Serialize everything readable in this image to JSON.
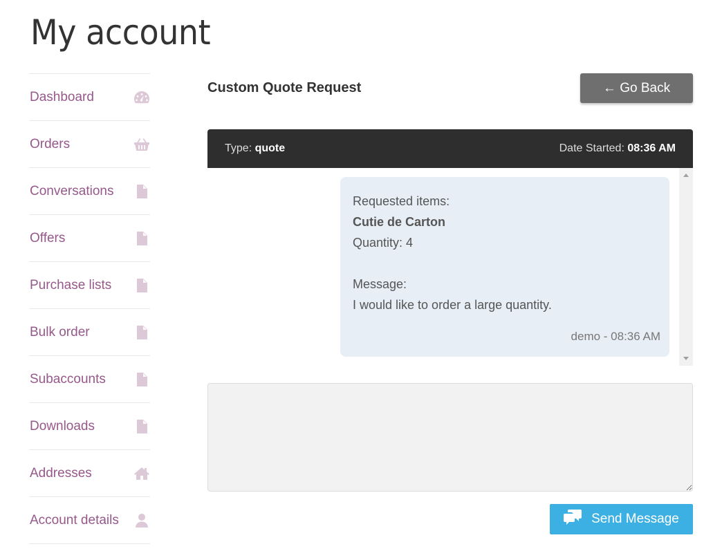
{
  "page": {
    "title": "My account"
  },
  "sidebar": {
    "items": [
      {
        "label": "Dashboard",
        "icon": "dashboard-icon"
      },
      {
        "label": "Orders",
        "icon": "basket-icon"
      },
      {
        "label": "Conversations",
        "icon": "document-icon"
      },
      {
        "label": "Offers",
        "icon": "document-icon"
      },
      {
        "label": "Purchase lists",
        "icon": "document-icon"
      },
      {
        "label": "Bulk order",
        "icon": "document-icon"
      },
      {
        "label": "Subaccounts",
        "icon": "document-icon"
      },
      {
        "label": "Downloads",
        "icon": "file-download-icon"
      },
      {
        "label": "Addresses",
        "icon": "home-icon"
      },
      {
        "label": "Account details",
        "icon": "user-icon"
      }
    ]
  },
  "conversation": {
    "title": "Custom Quote Request",
    "back_label": "← Go Back",
    "type_label": "Type:",
    "type_value": "quote",
    "date_label": "Date Started:",
    "date_value": "08:36 AM",
    "message": {
      "line1": "Requested items:",
      "item_name": "Cutie de Carton",
      "quantity": "Quantity: 4",
      "message_label": "Message:",
      "message_text": "I would like to order a large quantity.",
      "meta": "demo - 08:36 AM"
    },
    "reply_placeholder": "",
    "send_label": "Send Message"
  },
  "colors": {
    "accent": "#96588a",
    "nav_icon": "#ddc8d7",
    "send_button": "#3cb0e2",
    "back_button": "#6f6f6f",
    "header_bar": "#2e2e2e",
    "bubble": "#e8eef6"
  }
}
